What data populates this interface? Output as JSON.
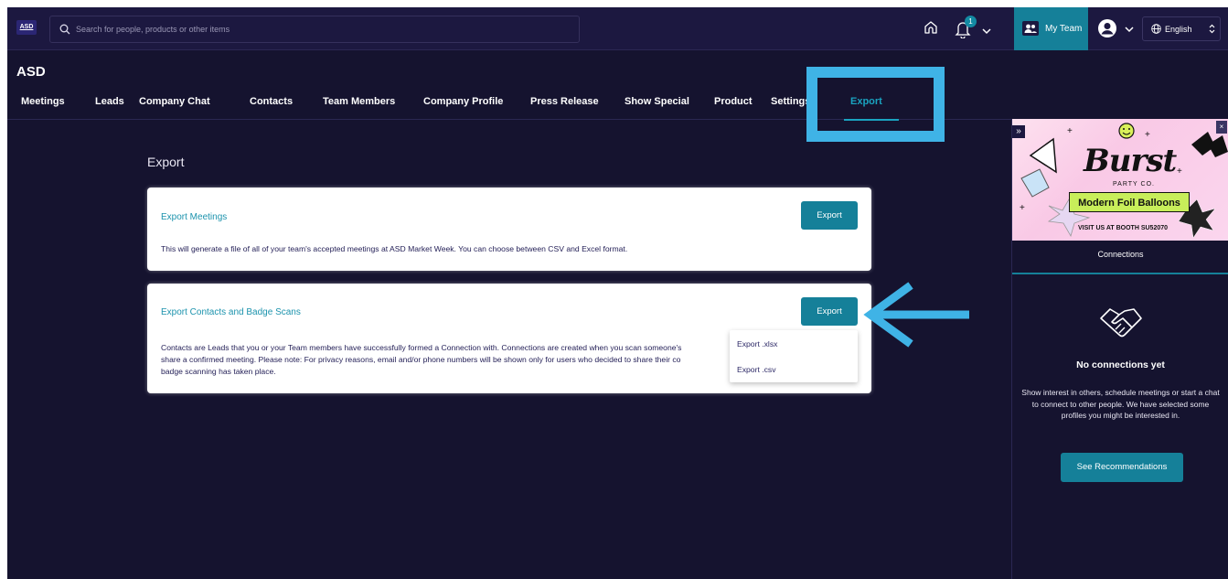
{
  "topbar": {
    "logo_text": "ASD",
    "search_placeholder": "Search for people, products or other items",
    "notification_count": "1",
    "my_team_label": "My Team",
    "language_label": "English"
  },
  "company": {
    "title": "ASD"
  },
  "tabs": [
    {
      "label": "Meetings"
    },
    {
      "label": "Leads"
    },
    {
      "label": "Company Chat"
    },
    {
      "label": "Contacts"
    },
    {
      "label": "Team Members"
    },
    {
      "label": "Company Profile"
    },
    {
      "label": "Press Release"
    },
    {
      "label": "Show Special"
    },
    {
      "label": "Product"
    },
    {
      "label": "Settings"
    },
    {
      "label": "Export"
    }
  ],
  "main": {
    "heading": "Export",
    "cards": [
      {
        "title": "Export Meetings",
        "button": "Export",
        "description": "This will generate a file of all of your team's accepted meetings at ASD Market Week. You can choose between CSV and Excel format."
      },
      {
        "title": "Export Contacts and Badge Scans",
        "button": "Export",
        "description_lines": [
          "Contacts are Leads that you or your Team members have successfully formed a Connection with. Connections are created when you scan someone's",
          "share a confirmed meeting. Please note: For privacy reasons, email and/or phone numbers will be shown only for users who decided to share their co",
          "badge scanning has taken place."
        ]
      }
    ],
    "dropdown": {
      "items": [
        "Export .xlsx",
        "Export .csv"
      ]
    }
  },
  "sidepanel": {
    "ad": {
      "brand": "Burst",
      "tagline": "PARTY CO.",
      "headline": "Modern Foil Balloons",
      "booth": "VISIT US AT BOOTH SU52070",
      "close": "×",
      "collapse": "»"
    },
    "tab_label": "Connections",
    "empty_title": "No connections yet",
    "empty_desc": "Show interest in others, schedule meetings or start a chat to connect to other people. We have selected some profiles you might be interested in.",
    "cta_label": "See Recommendations"
  },
  "colors": {
    "background": "#15132f",
    "accent": "#158099",
    "active_tab": "#1aa3c0",
    "annotation": "#3fb3e6"
  }
}
